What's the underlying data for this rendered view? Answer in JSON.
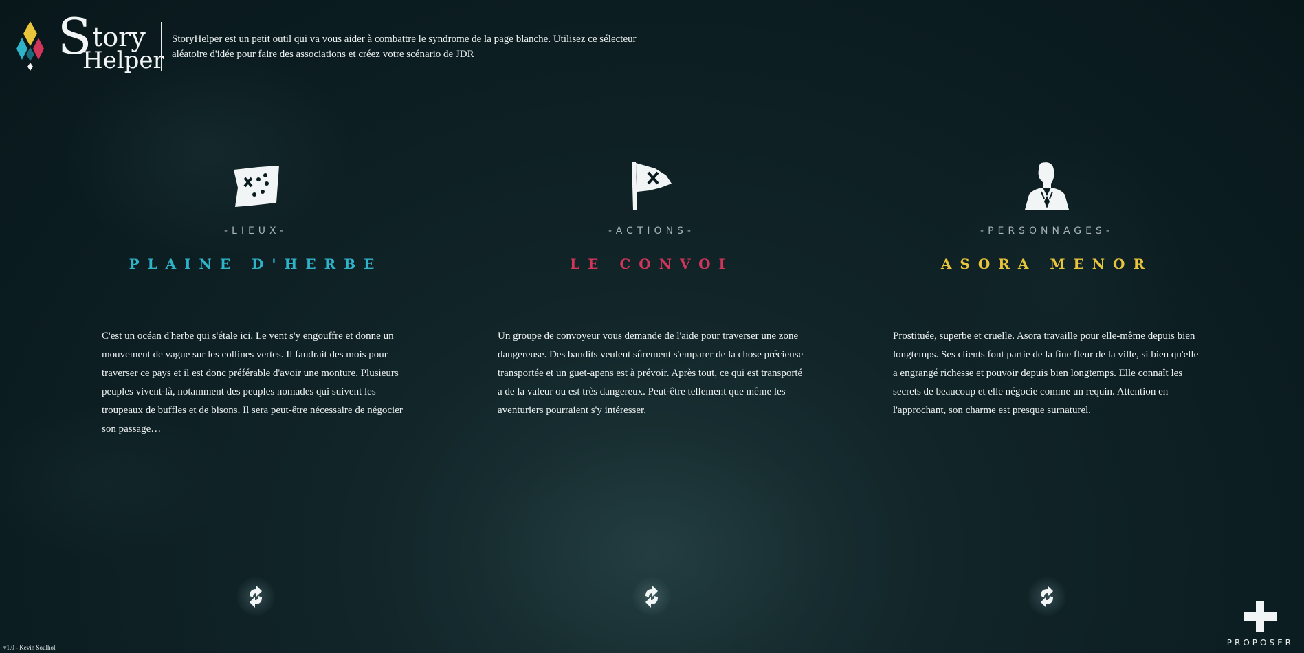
{
  "brand": {
    "logo_s": "S",
    "logo_story": "tory",
    "logo_helper": "Helper",
    "colors": {
      "yellow": "#e8c53a",
      "cyan": "#2fb3c9",
      "red": "#d0355a"
    }
  },
  "header": {
    "tagline": "StoryHelper est un petit outil qui va vous aider à combattre le syndrome de la page blanche. Utilisez ce sélecteur aléatoire d'idée pour faire des associations et créez votre scénario de JDR"
  },
  "columns": [
    {
      "icon": "treasure-map-icon",
      "category": "-LIEUX-",
      "title": "PLAINE D'HERBE",
      "color": "#2fb3c9",
      "description": "C'est un océan d'herbe qui s'étale ici. Le vent s'y engouffre et donne un mouvement de vague sur les collines vertes. Il faudrait des mois pour traverser ce pays et il est donc préférable d'avoir une monture. Plusieurs peuples vivent-là, notamment des peuples nomades qui suivent les troupeaux de buffles et de bisons. Il sera peut-être nécessaire de négocier son passage…"
    },
    {
      "icon": "flag-icon",
      "category": "-ACTIONS-",
      "title": "LE CONVOI",
      "color": "#d0355a",
      "description": "Un groupe de convoyeur vous demande de l'aide pour traverser une zone dangereuse. Des bandits veulent sûrement s'emparer de la chose précieuse transportée et un guet-apens est à prévoir. Après tout, ce qui est transporté a de la valeur ou est très dangereux. Peut-être tellement que même les aventuriers pourraient s'y intéresser."
    },
    {
      "icon": "person-bust-icon",
      "category": "-PERSONNAGES-",
      "title": "ASORA MENOR",
      "color": "#e8c53a",
      "description": "Prostituée, superbe et cruelle. Asora travaille pour elle-même depuis bien longtemps. Ses clients font partie de la fine fleur de la ville, si bien qu'elle a engrangé richesse et pouvoir depuis bien longtemps. Elle connaît les secrets de beaucoup et elle négocie comme un requin. Attention en l'approchant, son charme est presque surnaturel."
    }
  ],
  "propose": {
    "label": "PROPOSER",
    "icon": "plus-icon"
  },
  "footer": {
    "version": "v1.0 - Kevin Soulhol"
  }
}
